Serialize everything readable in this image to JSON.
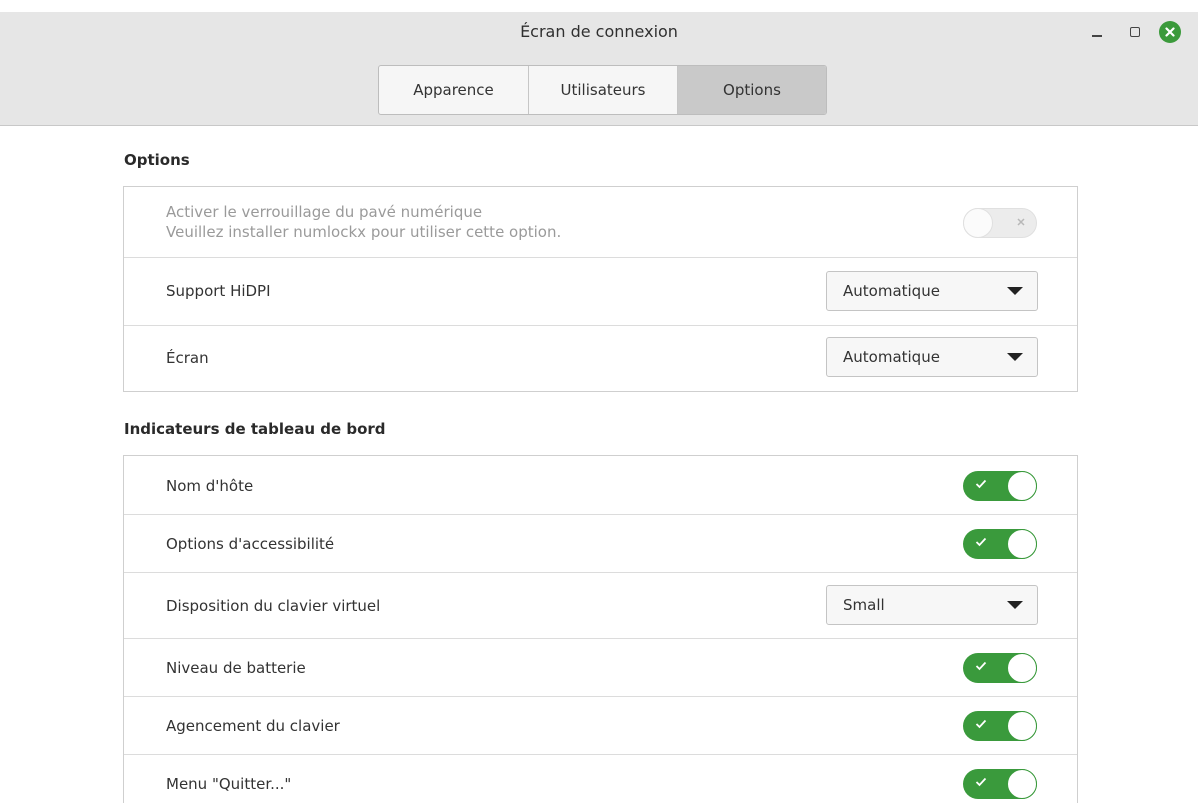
{
  "window": {
    "title": "Écran de connexion",
    "controls": [
      "minimize-icon",
      "maximize-icon",
      "close-icon"
    ],
    "accent_color": "#3a9a3c"
  },
  "tabs": [
    {
      "label": "Apparence",
      "selected": false
    },
    {
      "label": "Utilisateurs",
      "selected": false
    },
    {
      "label": "Options",
      "selected": true
    }
  ],
  "options_section": {
    "title": "Options",
    "numlock": {
      "label_line1": "Activer le verrouillage du pavé numérique",
      "label_line2": "Veuillez installer numlockx pour utiliser cette option.",
      "enabled": false,
      "disabled": true
    },
    "hidpi": {
      "label": "Support HiDPI",
      "value": "Automatique"
    },
    "screen": {
      "label": "Écran",
      "value": "Automatique"
    }
  },
  "indicators_section": {
    "title": "Indicateurs de tableau de bord",
    "hostname": {
      "label": "Nom d'hôte",
      "enabled": true
    },
    "accessibility": {
      "label": "Options d'accessibilité",
      "enabled": true
    },
    "virtual_keyboard": {
      "label": "Disposition du clavier virtuel",
      "value": "Small"
    },
    "battery": {
      "label": "Niveau de batterie",
      "enabled": true
    },
    "keyboard_layout": {
      "label": "Agencement du clavier",
      "enabled": true
    },
    "quit_menu": {
      "label": "Menu \"Quitter...\"",
      "enabled": true
    }
  }
}
